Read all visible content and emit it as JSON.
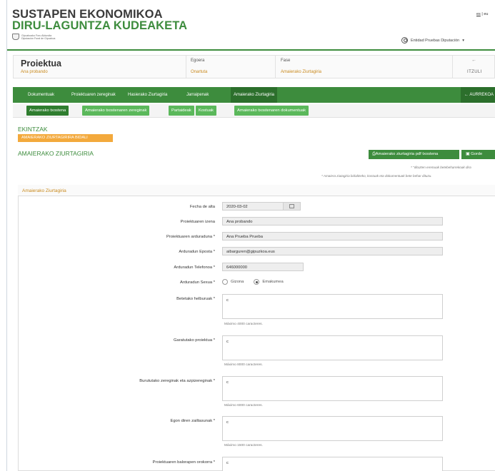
{
  "header": {
    "title_line1": "SUSTAPEN EKONOMIKOA",
    "title_line2": "DIRU-LAGUNTZA KUDEAKETA",
    "logo_line1": "Gipuzkoako Foru Aldundia",
    "logo_line2": "Diputación Foral de Gipuzkoa",
    "lang_selected": "es",
    "lang_other": "eu",
    "user_name": "Entidad Pruebas Diputación",
    "user_caret": "▾"
  },
  "project": {
    "title": "Proiektua",
    "name": "Ana probando",
    "state_label": "Egoera",
    "state_value": "Onartuta",
    "phase_label": "Fase",
    "phase_value": "Amaierako Ziurtagiria",
    "back_arrow": "←",
    "back_label": "ITZULI"
  },
  "main_nav": {
    "items": [
      "Dokumentuak",
      "Proiektuaren zereginak",
      "Hasierako Ziurtagiria",
      "Jarraipenak",
      "Amaierako Ziurtagiria"
    ],
    "active_index": 4,
    "prev_label": "← AURREKOA"
  },
  "sub_tabs": {
    "items": [
      "Amaierako txostena",
      "Amaierako txostenaren zereginak",
      "Partaideak",
      "Kostuak",
      "Amaierako txostenaren dokumentuak"
    ],
    "active_index": 0
  },
  "actions": {
    "heading": "EKINTZAK",
    "send_button": "AMAIERAKO ZIURTAGIRIRA BIDALI"
  },
  "section": {
    "title": "AMAIERAKO ZIURTAGIRIA",
    "pdf_button": "Amaierako ziurtagiria pdf txostena",
    "save_button": "Gorde",
    "note_required": "* \"dituzten eremuak betebeharrekoak dira",
    "note_costs": "* Amaiera ziutagiria bidaltzeko, kostuak eta dokumentuak bete behar dituzu."
  },
  "panel": {
    "title": "Amaierako Ziurtagiria",
    "fields": {
      "fecha_alta_label": "Fecha de alta",
      "fecha_alta_value": "2020-03-02",
      "izena_label": "Proiektuaren izena",
      "izena_value": "Ana probando",
      "arduraduna_label": "Proiektuaren arduraduna *",
      "arduraduna_value": "Ana Prueba Prueba",
      "eposta_label": "Arduradun Eposta *",
      "eposta_value": "aibarguren@gipuzkoa.eus",
      "telefonoa_label": "Arduradun Telefonoa *",
      "telefonoa_value": "646000000",
      "sexua_label": "Arduradun Sexua *",
      "sexua_option_male": "Gizona",
      "sexua_option_female": "Emakumea",
      "helburuak_label": "Betetako helburuak *",
      "helburuak_value": "c",
      "helburuak_hint": "Máximo 4000 caracteres.",
      "garatutako_label": "Garatutako proiektua *",
      "garatutako_value": "c",
      "garatutako_hint": "Máximo 8000 caracteres.",
      "zereginak_label": "Burututako zereginak eta azpizereginak *",
      "zereginak_value": "c",
      "zereginak_hint": "Máximo 6000 caracteres.",
      "zailtasunak_label": "Egon diren zailtasunak *",
      "zailtasunak_value": "c",
      "zailtasunak_hint": "Máximo 1500 caracteres.",
      "balorapena_label": "Proiektuaren balorapen orokorra *",
      "balorapena_value": "c"
    }
  }
}
